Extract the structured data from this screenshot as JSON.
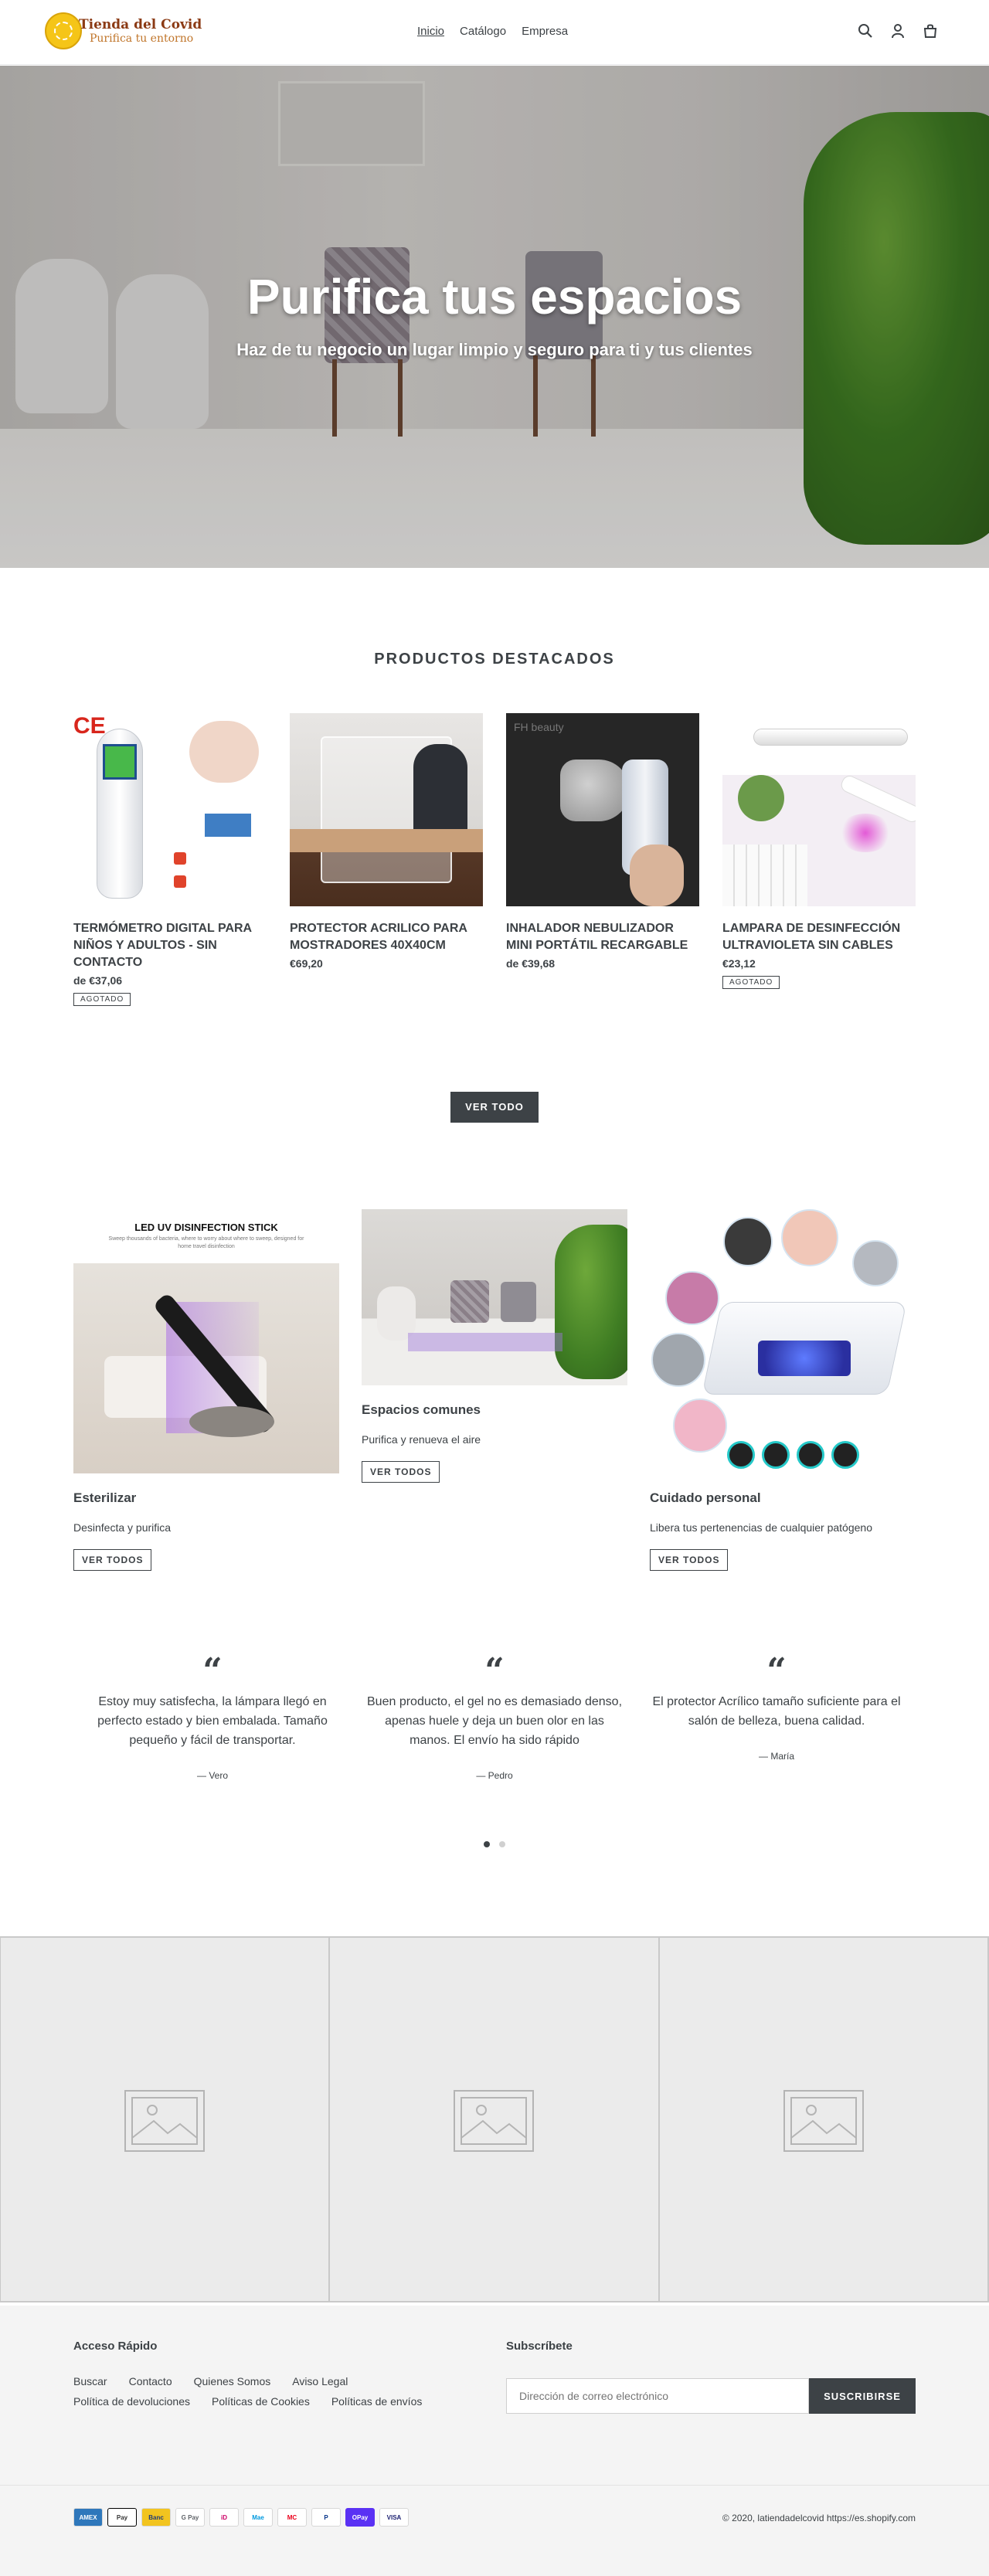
{
  "header": {
    "logo_title": "Tienda del Covid",
    "logo_subtitle": "Purifica tu entorno",
    "nav": [
      "Inicio",
      "Catálogo",
      "Empresa"
    ],
    "icons": [
      "search-icon",
      "account-icon",
      "cart-icon"
    ]
  },
  "hero": {
    "title": "Purifica tus espacios",
    "subtitle": "Haz de tu negocio un lugar limpio y seguro para ti y tus clientes"
  },
  "featured": {
    "title": "PRODUCTOS DESTACADOS",
    "products": [
      {
        "name": "TERMÓMETRO DIGITAL PARA NIÑOS Y ADULTOS - SIN CONTACTO",
        "price": "de €37,06",
        "badge": "AGOTADO",
        "image_label": "CE"
      },
      {
        "name": "PROTECTOR ACRILICO PARA MOSTRADORES 40x40cm",
        "price": "€69,20",
        "badge": ""
      },
      {
        "name": "INHALADOR NEBULIZADOR MINI PORTÁTIL RECARGABLE",
        "price": "de €39,68",
        "badge": "",
        "image_label": "FH beauty"
      },
      {
        "name": "LAMPARA DE DESINFECCIÓN ULTRAVIOLETA SIN CABLES",
        "price": "€23,12",
        "badge": "AGOTADO"
      }
    ],
    "view_all": "VER TODO"
  },
  "collections": [
    {
      "title": "Esterilizar",
      "desc": "Desinfecta y purifica",
      "button": "VER TODOS",
      "image_title": "LED UV DISINFECTION STICK",
      "image_sub": "Sweep thousands of bacteria, where to worry about where to sweep, designed for home travel disinfection"
    },
    {
      "title": "Espacios comunes",
      "desc": "Purifica y renueva el aire",
      "button": "VER TODOS"
    },
    {
      "title": "Cuidado personal",
      "desc": "Libera tus pertenencias de cualquier patógeno",
      "button": "VER TODOS"
    }
  ],
  "testimonials": [
    {
      "quote": "Estoy muy satisfecha, la lámpara llegó en perfecto estado y bien embalada.  Tamaño pequeño y fácil de transportar.",
      "author": "— Vero"
    },
    {
      "quote": "Buen producto, el gel no es demasiado denso, apenas huele y deja un buen olor en las manos. El envío ha sido rápido",
      "author": "— Pedro"
    },
    {
      "quote": "El protector Acrílico tamaño suficiente para el salón de belleza, buena calidad.",
      "author": "— María"
    }
  ],
  "footer": {
    "quick_title": "Acceso Rápido",
    "links": [
      "Buscar",
      "Contacto",
      "Quienes Somos",
      "Aviso Legal",
      "Política de devoluciones",
      "Políticas de Cookies",
      "Políticas de envíos"
    ],
    "subscribe_title": "Subscríbete",
    "email_placeholder": "Dirección de correo electrónico",
    "subscribe_button": "SUSCRIBIRSE",
    "payments": [
      "AMEX",
      "Pay",
      "Banc",
      "G Pay",
      "iD",
      "Mae",
      "MC",
      "P",
      "OPay",
      "VISA"
    ],
    "copyright": "© 2020, latiendadelcovid https://es.shopify.com"
  }
}
